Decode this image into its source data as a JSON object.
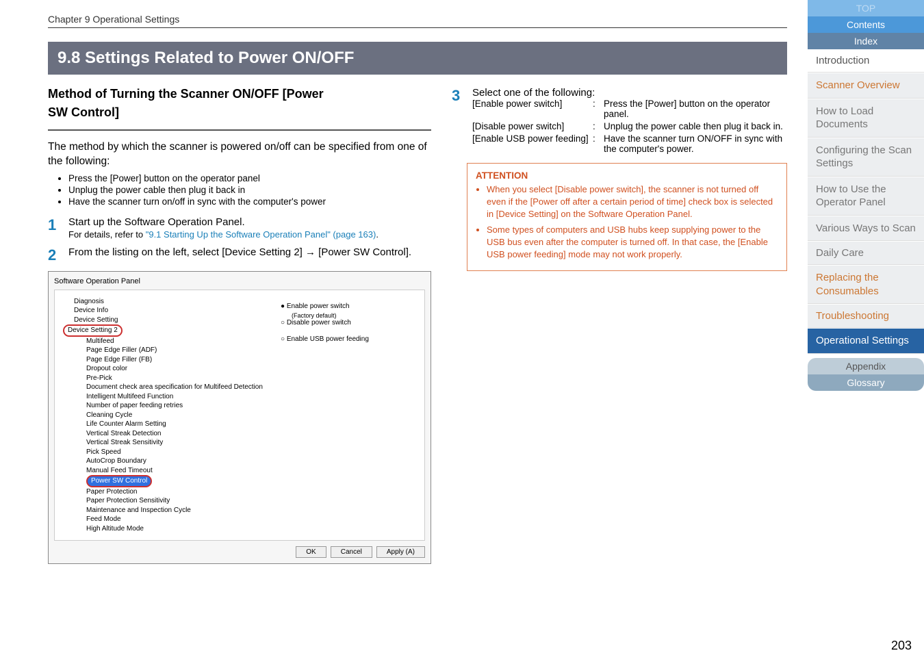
{
  "chapter_header": "Chapter 9 Operational Settings",
  "section_title": "9.8 Settings Related to Power ON/OFF",
  "left": {
    "subhead_l1": "Method of Turning the Scanner ON/OFF [Power",
    "subhead_l2": "SW Control]",
    "para1": "The method by which the scanner is powered on/off can be specified from one of the following:",
    "bullets": [
      "Press the [Power] button on the operator panel",
      "Unplug the power cable then plug it back in",
      "Have the scanner turn on/off in sync with the computer's power"
    ],
    "step1_text": "Start up the Software Operation Panel.",
    "step1_sub_prefix": "For details, refer to ",
    "step1_link": "\"9.1 Starting Up the Software Operation Panel\" (page 163)",
    "step1_sub_suffix": ".",
    "step2_text": "From the listing on the left, select [Device Setting 2] → [Power SW Control]."
  },
  "panel": {
    "title": "Software Operation Panel",
    "tree": {
      "diagnosis": "Diagnosis",
      "device_info": "Device Info",
      "device_setting": "Device Setting",
      "device_setting_2": "Device Setting 2",
      "multifeed": "Multifeed",
      "edge_adf": "Page Edge Filler (ADF)",
      "edge_fb": "Page Edge Filler (FB)",
      "dropout": "Dropout color",
      "prepick": "Pre-Pick",
      "doc_check": "Document check area specification for Multifeed Detection",
      "intel_mf": "Intelligent Multifeed Function",
      "retries": "Number of paper feeding retries",
      "clean_cycle": "Cleaning Cycle",
      "life_counter": "Life Counter Alarm Setting",
      "vstreak_det": "Vertical Streak Detection",
      "vstreak_sens": "Vertical Streak Sensitivity",
      "pick_speed": "Pick Speed",
      "autocrop": "AutoCrop Boundary",
      "manual_feed": "Manual Feed Timeout",
      "power_sw": "Power SW Control",
      "paper_protect": "Paper Protection",
      "pp_sens": "Paper Protection Sensitivity",
      "maint": "Maintenance and Inspection Cycle",
      "feed_mode": "Feed Mode",
      "high_alt": "High Altitude Mode"
    },
    "radios": {
      "r1": "Enable power switch",
      "r1_sub": "(Factory default)",
      "r2": "Disable power switch",
      "r3": "Enable USB power feeding"
    },
    "buttons": {
      "ok": "OK",
      "cancel": "Cancel",
      "apply": "Apply (A)"
    }
  },
  "right": {
    "step3_text": "Select one of the following:",
    "opts": [
      {
        "label": "[Enable power switch]",
        "desc": "Press the [Power] button on the operator panel."
      },
      {
        "label": "[Disable power switch]",
        "desc": "Unplug the power cable then plug it back in."
      },
      {
        "label": "[Enable USB power feeding]",
        "desc": "Have the scanner turn ON/OFF in sync with the computer's power."
      }
    ],
    "attention_title": "ATTENTION",
    "attention_items": [
      "When you select [Disable power switch], the scanner is not turned off even if the [Power off after a certain period of time] check box is selected in [Device Setting] on the Software Operation Panel.",
      "Some types of computers and USB hubs keep supplying power to the USB bus even after the computer is turned off.\nIn that case, the [Enable USB power feeding] mode may not work properly."
    ]
  },
  "sidebar": {
    "top": "TOP",
    "contents": "Contents",
    "index": "Index",
    "introduction": "Introduction",
    "items": [
      "Scanner Overview",
      "How to Load Documents",
      "Configuring the Scan Settings",
      "How to Use the Operator Panel",
      "Various Ways to Scan",
      "Daily Care",
      "Replacing the Consumables",
      "Troubleshooting",
      "Operational Settings"
    ],
    "appendix": "Appendix",
    "glossary": "Glossary"
  },
  "page_number": "203"
}
